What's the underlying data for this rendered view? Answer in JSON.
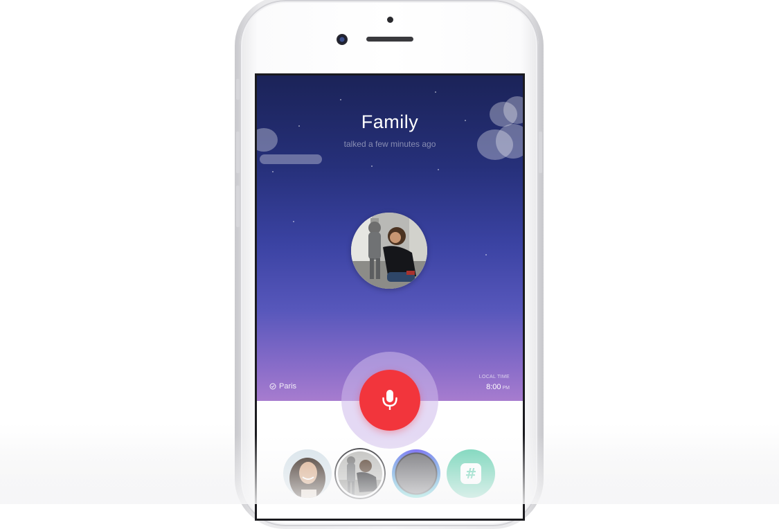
{
  "conversation": {
    "title": "Family",
    "subtitle": "talked a few minutes ago"
  },
  "location": {
    "city": "Paris"
  },
  "local_time": {
    "label": "LOCAL TIME",
    "time": "8:00",
    "ampm": "PM"
  },
  "icons": {
    "location": "location-check-icon",
    "mic": "microphone-icon",
    "slack": "slack-hash-icon"
  },
  "colors": {
    "mic_button": "#f2353c",
    "sky_top": "#1b2358",
    "sky_bottom": "#a77ccf",
    "slack_bg": "#6ed3b5"
  },
  "contacts": [
    {
      "kind": "photo-woman"
    },
    {
      "kind": "photo-family",
      "selected": true
    },
    {
      "kind": "gradient-ring"
    },
    {
      "kind": "slack"
    }
  ]
}
